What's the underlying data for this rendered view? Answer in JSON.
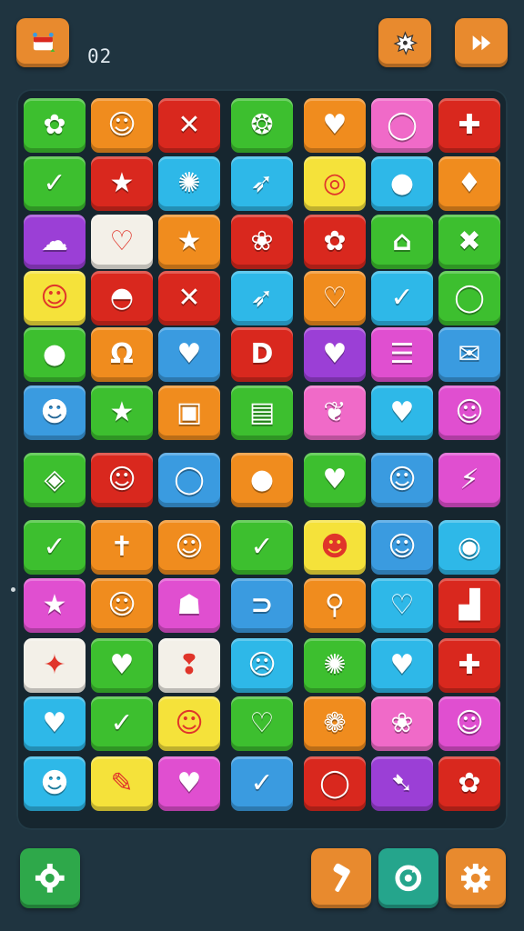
{
  "hud": {
    "level_value": "02",
    "top_left_icon": "treasure-box-icon",
    "top_right_icons": [
      "splat-icon",
      "fast-forward-icon"
    ],
    "bottom_left_icon": "gear-icon",
    "bottom_right_icons": [
      "hammer-icon",
      "refresh-gear-icon",
      "gear-icon"
    ]
  },
  "colors": {
    "g": "#3dbf2f",
    "o": "#f08c1e",
    "r": "#d9281e",
    "p": "#f06ac8",
    "y": "#f5e23a",
    "c": "#2eb8e8",
    "b": "#3a9be0",
    "v": "#9b3fd6",
    "w": "#f3f0e8",
    "m": "#e04fd0"
  },
  "board": {
    "rows": [
      [
        {
          "c": "g",
          "s": "✿"
        },
        {
          "c": "o",
          "s": "☺"
        },
        {
          "c": "r",
          "s": "✕"
        },
        {
          "c": "g",
          "s": "❂"
        },
        {
          "c": "o",
          "s": "♥"
        },
        {
          "c": "p",
          "s": "◯"
        },
        {
          "c": "r",
          "s": "✚"
        }
      ],
      [
        {
          "c": "g",
          "s": "✓"
        },
        {
          "c": "r",
          "s": "★"
        },
        {
          "c": "c",
          "s": "✺"
        },
        {
          "c": "c",
          "s": "➶"
        },
        {
          "c": "y",
          "s": "◎"
        },
        {
          "c": "c",
          "s": "●"
        },
        {
          "c": "o",
          "s": "♦"
        }
      ],
      [
        {
          "c": "v",
          "s": "☁"
        },
        {
          "c": "w",
          "s": "♡"
        },
        {
          "c": "o",
          "s": "★"
        },
        {
          "c": "r",
          "s": "❀"
        },
        {
          "c": "r",
          "s": "✿"
        },
        {
          "c": "g",
          "s": "⌂"
        },
        {
          "c": "g",
          "s": "✖"
        }
      ],
      [
        {
          "c": "y",
          "s": "☺"
        },
        {
          "c": "r",
          "s": "◓"
        },
        {
          "c": "r",
          "s": "✕"
        },
        {
          "c": "c",
          "s": "➶"
        },
        {
          "c": "o",
          "s": "♡"
        },
        {
          "c": "c",
          "s": "✓"
        },
        {
          "c": "g",
          "s": "◯"
        }
      ],
      [
        {
          "c": "g",
          "s": "●"
        },
        {
          "c": "o",
          "s": "Ω"
        },
        {
          "c": "b",
          "s": "♥"
        },
        {
          "c": "r",
          "s": "D"
        },
        {
          "c": "v",
          "s": "♥"
        },
        {
          "c": "m",
          "s": "☰"
        },
        {
          "c": "b",
          "s": "✉"
        }
      ],
      [
        {
          "c": "b",
          "s": "☻"
        },
        {
          "c": "g",
          "s": "★"
        },
        {
          "c": "o",
          "s": "▣"
        },
        {
          "c": "g",
          "s": "▤"
        },
        {
          "c": "p",
          "s": "❦"
        },
        {
          "c": "c",
          "s": "♥"
        },
        {
          "c": "m",
          "s": "☺"
        }
      ],
      [
        {
          "c": "g",
          "s": "◈"
        },
        {
          "c": "r",
          "s": "☺"
        },
        {
          "c": "b",
          "s": "◯"
        },
        {
          "c": "o",
          "s": "●"
        },
        {
          "c": "g",
          "s": "♥"
        },
        {
          "c": "b",
          "s": "☺"
        },
        {
          "c": "m",
          "s": "⚡"
        }
      ],
      [
        {
          "c": "g",
          "s": "✓"
        },
        {
          "c": "o",
          "s": "✝"
        },
        {
          "c": "o",
          "s": "☺"
        },
        {
          "c": "g",
          "s": "✓"
        },
        {
          "c": "y",
          "s": "☻"
        },
        {
          "c": "b",
          "s": "☺"
        },
        {
          "c": "c",
          "s": "◉"
        }
      ],
      [
        {
          "c": "m",
          "s": "★"
        },
        {
          "c": "o",
          "s": "☺"
        },
        {
          "c": "m",
          "s": "☗"
        },
        {
          "c": "b",
          "s": "⊃"
        },
        {
          "c": "o",
          "s": "⚲"
        },
        {
          "c": "c",
          "s": "♡"
        },
        {
          "c": "r",
          "s": "▟"
        }
      ],
      [
        {
          "c": "w",
          "s": "✦"
        },
        {
          "c": "g",
          "s": "♥"
        },
        {
          "c": "w",
          "s": "❢"
        },
        {
          "c": "c",
          "s": "☹"
        },
        {
          "c": "g",
          "s": "✺"
        },
        {
          "c": "c",
          "s": "♥"
        },
        {
          "c": "r",
          "s": "✚"
        }
      ],
      [
        {
          "c": "c",
          "s": "♥"
        },
        {
          "c": "g",
          "s": "✓"
        },
        {
          "c": "y",
          "s": "☺"
        },
        {
          "c": "g",
          "s": "♡"
        },
        {
          "c": "o",
          "s": "❁"
        },
        {
          "c": "p",
          "s": "❀"
        },
        {
          "c": "m",
          "s": "☺"
        }
      ],
      [
        {
          "c": "c",
          "s": "☻"
        },
        {
          "c": "y",
          "s": "✎"
        },
        {
          "c": "m",
          "s": "♥"
        },
        {
          "c": "b",
          "s": "✓"
        },
        {
          "c": "r",
          "s": "◯"
        },
        {
          "c": "v",
          "s": "➷"
        },
        {
          "c": "r",
          "s": "✿"
        }
      ]
    ]
  }
}
